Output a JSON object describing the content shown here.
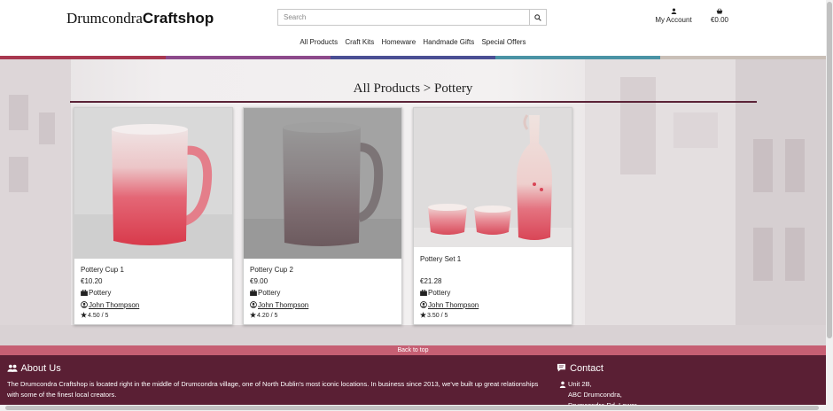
{
  "header": {
    "logo_regular": "Drumcondra",
    "logo_bold": "Craftshop",
    "search_placeholder": "Search",
    "account_label": "My Account",
    "basket_total": "€0.00"
  },
  "nav": [
    "All Products",
    "Craft Kits",
    "Homeware",
    "Handmade Gifts",
    "Special Offers"
  ],
  "stripe_colors": [
    "#a8384f",
    "#8d4a8b",
    "#4a4f94",
    "#4a93a5",
    "#c9bfb7"
  ],
  "breadcrumb": "All Products > Pottery",
  "products": [
    {
      "name": "Pottery Cup 1",
      "price": "€10.20",
      "category": "Pottery",
      "maker": "John Thompson",
      "rating": "4.50 / 5"
    },
    {
      "name": "Pottery Cup 2",
      "price": "€9.00",
      "category": "Pottery",
      "maker": "John Thompson",
      "rating": "4.20 / 5"
    },
    {
      "name": "Pottery Set 1",
      "price": "€21.28",
      "category": "Pottery",
      "maker": "John Thompson",
      "rating": "3.50 / 5"
    }
  ],
  "back_to_top": "Back to top",
  "footer": {
    "about_title": "About Us",
    "about_text": "The Drumcondra Craftshop is located right in the middle of Drumcondra village, one of North Dublin's most iconic locations. In business since 2013, we've built up great relationships with some of the finest local creators.",
    "contact_title": "Contact",
    "address": [
      "Unit 2B,",
      "ABC Drumcondra,",
      "Drumcondra Rd. Lower,"
    ]
  },
  "colors": {
    "footer": "#5a1f34",
    "back_to_top": "#c65f73",
    "underline": "#5b2337"
  },
  "icons": [
    "search-icon",
    "user-icon",
    "basket-icon",
    "briefcase-icon",
    "user-circle-icon",
    "star-icon",
    "users-icon",
    "comment-icon",
    "map-marker-icon"
  ]
}
